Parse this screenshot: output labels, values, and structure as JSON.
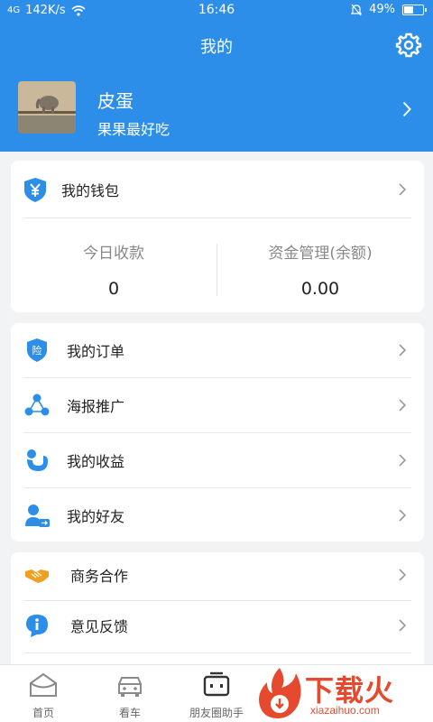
{
  "status": {
    "signal": "4G",
    "speed": "142K/s",
    "time": "16:46",
    "battery": "49%"
  },
  "header": {
    "title": "我的"
  },
  "profile": {
    "name": "皮蛋",
    "subtitle": "果果最好吃"
  },
  "wallet": {
    "label": "我的钱包",
    "today_label": "今日收款",
    "today_value": "0",
    "funds_label": "资金管理(余额)",
    "funds_value": "0.00"
  },
  "menu1": [
    {
      "label": "我的订单",
      "icon": "insurance-shield-icon"
    },
    {
      "label": "海报推广",
      "icon": "share-nodes-icon"
    },
    {
      "label": "我的收益",
      "icon": "earnings-icon"
    },
    {
      "label": "我的好友",
      "icon": "friend-icon"
    }
  ],
  "menu2": [
    {
      "label": "商务合作",
      "icon": "handshake-icon"
    },
    {
      "label": "意见反馈",
      "icon": "info-bubble-icon"
    }
  ],
  "tabs": [
    {
      "label": "首页",
      "icon": "home-icon"
    },
    {
      "label": "看车",
      "icon": "car-icon"
    },
    {
      "label": "朋友圈助手",
      "icon": "robot-icon"
    }
  ],
  "watermark": {
    "cn": "下载火",
    "en": "xiazaihuo.com"
  },
  "colors": {
    "primary": "#2c8ee8",
    "accent": "#f0a020",
    "watermark": "#e64a2e"
  }
}
